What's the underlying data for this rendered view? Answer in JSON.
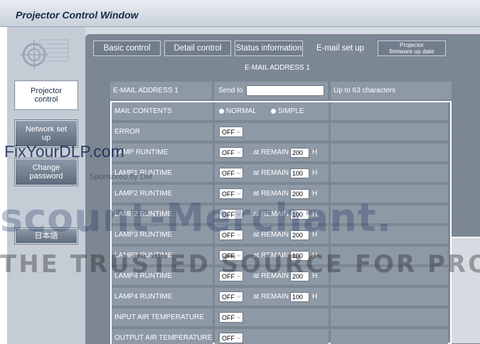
{
  "window": {
    "title": "Projector Control Window"
  },
  "sidebar": {
    "items": [
      {
        "label": "Projector control"
      },
      {
        "label": "Network set up"
      },
      {
        "label": "Change password"
      },
      {
        "label": "日本語"
      }
    ]
  },
  "tabs": [
    {
      "label": "Basic control"
    },
    {
      "label": "Detail control"
    },
    {
      "label": "Status information"
    },
    {
      "label": "E-mail set up"
    },
    {
      "label_line1": "Projector",
      "label_line2": "firmware up date"
    }
  ],
  "section_title": "E-MAIL ADDRESS 1",
  "email": {
    "label": "E-MAIL ADDRESS 1",
    "send_to": "Send to",
    "value": "",
    "hint": "Up to 63 characters"
  },
  "mail_contents": {
    "label": "MAIL CONTENTS",
    "option_normal": "NORMAL",
    "option_simple": "SIMPLE"
  },
  "rows": [
    {
      "label": "ERROR",
      "select": "OFF"
    },
    {
      "label": "LAMP RUNTIME",
      "select": "OFF",
      "remain_label": "at REMAIN",
      "remain": "200",
      "unit": "H"
    },
    {
      "label": "LAMP1 RUNTIME",
      "select": "OFF",
      "remain_label": "at REMAIN",
      "remain": "100",
      "unit": "H"
    },
    {
      "label": "LAMP2 RUNTIME",
      "select": "OFF",
      "remain_label": "at REMAIN",
      "remain": "200",
      "unit": "H"
    },
    {
      "label": "LAMP2 RUNTIME",
      "select": "OFF",
      "remain_label": "at REMAIN",
      "remain": "100",
      "unit": "H"
    },
    {
      "label": "LAMP3 RUNTIME",
      "select": "OFF",
      "remain_label": "at REMAIN",
      "remain": "200",
      "unit": "H"
    },
    {
      "label": "LAMP3 RUNTIME",
      "select": "OFF",
      "remain_label": "at REMAIN",
      "remain": "100",
      "unit": "H"
    },
    {
      "label": "LAMP4 RUNTIME",
      "select": "OFF",
      "remain_label": "at REMAIN",
      "remain": "200",
      "unit": "H"
    },
    {
      "label": "LAMP4 RUNTIME",
      "select": "OFF",
      "remain_label": "at REMAIN",
      "remain": "100",
      "unit": "H"
    },
    {
      "label": "INPUT AIR TEMPERATURE",
      "select": "OFF"
    },
    {
      "label": "OUTPUT AIR TEMPERATURE",
      "select": "OFF"
    }
  ],
  "watermark": {
    "site": "FixYourDLP.com",
    "sponsored": "Sponsored by DM",
    "big": "scount-Merchant.",
    "strip": "THE TRUSTED SOURCE FOR PROJE"
  },
  "colors": {
    "panel": "#7c8794",
    "cell": "#8e99a6",
    "tab": "#717d8b",
    "sidebar": "#c5ccd6",
    "watermark": "#12285a"
  },
  "icons": {
    "select_arrow": "chevron-down-icon",
    "logo": "target-logo-icon"
  }
}
